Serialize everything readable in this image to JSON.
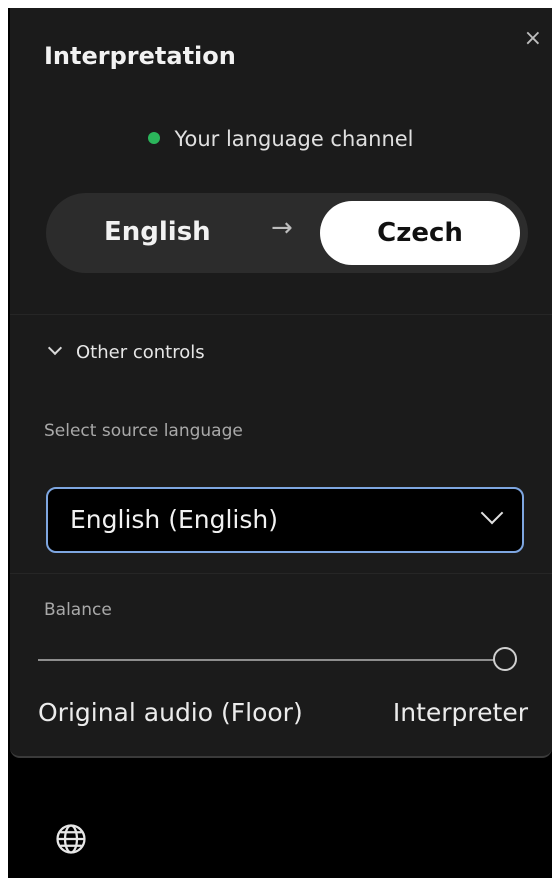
{
  "panel": {
    "title": "Interpretation",
    "close_symbol": "×",
    "close_icon": "close-icon"
  },
  "channel": {
    "label": "Your language channel",
    "indicator_color": "#2bb55b"
  },
  "language_switch": {
    "from": "English",
    "arrow": "→",
    "to": "Czech"
  },
  "other_controls": {
    "label": "Other controls",
    "expanded": true,
    "chevron_icon": "chevron-down-icon"
  },
  "source_language": {
    "label": "Select source language",
    "selected": "English (English)",
    "chevron_icon": "chevron-down-icon"
  },
  "balance": {
    "label": "Balance",
    "left_label": "Original audio (Floor)",
    "right_label": "Interpreter",
    "value_fraction": 1.0
  },
  "footer": {
    "icon": "globe-icon"
  },
  "colors": {
    "panel_bg": "#1b1b1b",
    "accent_border": "#7ea6e0"
  }
}
